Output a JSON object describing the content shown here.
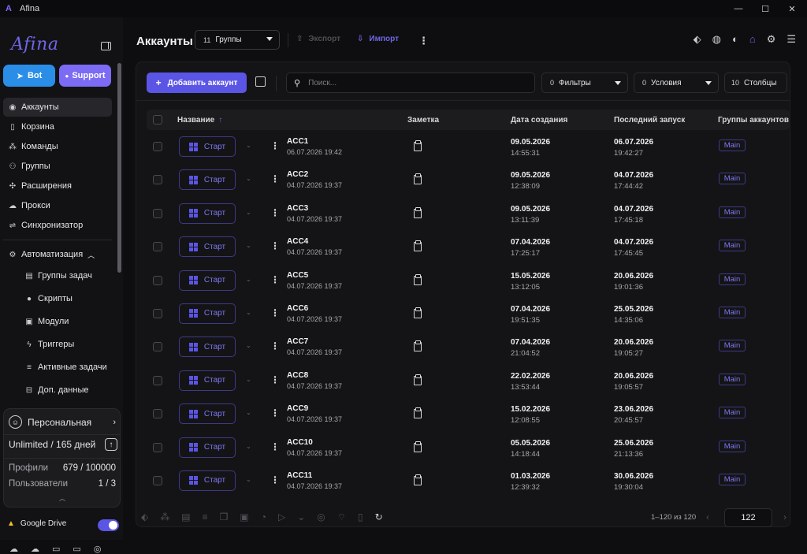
{
  "window": {
    "title": "Afina",
    "controls": [
      "minimize-icon",
      "maximize-icon",
      "close-icon"
    ]
  },
  "sidebar": {
    "brand": "Afina",
    "buttons": [
      {
        "label": "Bot",
        "color": "#2a8ee8"
      },
      {
        "label": "Support",
        "color": "#7c6cf5"
      }
    ],
    "items": [
      {
        "label": "Аккаунты",
        "icon": "user-circle-icon"
      },
      {
        "label": "Корзина",
        "icon": "trash-icon"
      },
      {
        "label": "Команды",
        "icon": "team-icon"
      },
      {
        "label": "Группы",
        "icon": "group-icon"
      },
      {
        "label": "Расширения",
        "icon": "puzzle-icon"
      },
      {
        "label": "Прокси",
        "icon": "cloud-icon"
      },
      {
        "label": "Синхронизатор",
        "icon": "sync-icon"
      }
    ],
    "automation": {
      "label": "Автоматизация",
      "subitems": [
        {
          "label": "Группы задач",
          "icon": "task-group-icon"
        },
        {
          "label": "Скрипты",
          "icon": "github-icon"
        },
        {
          "label": "Модули",
          "icon": "module-icon"
        },
        {
          "label": "Триггеры",
          "icon": "bolt-icon"
        },
        {
          "label": "Активные задачи",
          "icon": "list-icon"
        },
        {
          "label": "Доп. данные",
          "icon": "data-icon"
        }
      ]
    },
    "plan": {
      "name": "Персональная",
      "duration": "Unlimited / 165 дней",
      "profiles_label": "Профили",
      "profiles_value": "679 / 100000",
      "users_label": "Пользователи",
      "users_value": "1 / 3"
    },
    "gdrive": {
      "label": "Google Drive",
      "enabled": true
    }
  },
  "header": {
    "title": "Аккаунты",
    "group_count": "11",
    "group_label": "Группы",
    "export_label": "Экспорт",
    "import_label": "Импорт",
    "icons": [
      "tag-icon",
      "fingerprint-icon",
      "globe-icon",
      "robot-icon",
      "gear-icon",
      "layout-icon"
    ]
  },
  "toolbar": {
    "add_label": "Добавить аккаунт",
    "search_placeholder": "Поиск...",
    "filters_count": "0",
    "filters_label": "Фильтры",
    "conditions_count": "0",
    "conditions_label": "Условия",
    "columns_count": "10",
    "columns_label": "Столбцы"
  },
  "table": {
    "columns": [
      "Название",
      "Заметка",
      "Дата создания",
      "Последний запуск",
      "Группы аккаунтов"
    ],
    "start_label": "Старт",
    "rows": [
      {
        "name": "ACC1",
        "sub": "06.07.2026 19:42",
        "created_date": "09.05.2026",
        "created_time": "14:55:31",
        "last_date": "06.07.2026",
        "last_time": "19:42:27",
        "group": "Main"
      },
      {
        "name": "ACC2",
        "sub": "04.07.2026 19:37",
        "created_date": "09.05.2026",
        "created_time": "12:38:09",
        "last_date": "04.07.2026",
        "last_time": "17:44:42",
        "group": "Main"
      },
      {
        "name": "ACC3",
        "sub": "04.07.2026 19:37",
        "created_date": "09.05.2026",
        "created_time": "13:11:39",
        "last_date": "04.07.2026",
        "last_time": "17:45:18",
        "group": "Main"
      },
      {
        "name": "ACC4",
        "sub": "04.07.2026 19:37",
        "created_date": "07.04.2026",
        "created_time": "17:25:17",
        "last_date": "04.07.2026",
        "last_time": "17:45:45",
        "group": "Main"
      },
      {
        "name": "ACC5",
        "sub": "04.07.2026 19:37",
        "created_date": "15.05.2026",
        "created_time": "13:12:05",
        "last_date": "20.06.2026",
        "last_time": "19:01:36",
        "group": "Main"
      },
      {
        "name": "ACC6",
        "sub": "04.07.2026 19:37",
        "created_date": "07.04.2026",
        "created_time": "19:51:35",
        "last_date": "25.05.2026",
        "last_time": "14:35:06",
        "group": "Main"
      },
      {
        "name": "ACC7",
        "sub": "04.07.2026 19:37",
        "created_date": "07.04.2026",
        "created_time": "21:04:52",
        "last_date": "20.06.2026",
        "last_time": "19:05:27",
        "group": "Main"
      },
      {
        "name": "ACC8",
        "sub": "04.07.2026 19:37",
        "created_date": "22.02.2026",
        "created_time": "13:53:44",
        "last_date": "20.06.2026",
        "last_time": "19:05:57",
        "group": "Main"
      },
      {
        "name": "ACC9",
        "sub": "04.07.2026 19:37",
        "created_date": "15.02.2026",
        "created_time": "12:08:55",
        "last_date": "23.06.2026",
        "last_time": "20:45:57",
        "group": "Main"
      },
      {
        "name": "ACC10",
        "sub": "04.07.2026 19:37",
        "created_date": "05.05.2026",
        "created_time": "14:18:44",
        "last_date": "25.06.2026",
        "last_time": "21:13:36",
        "group": "Main"
      },
      {
        "name": "ACC11",
        "sub": "04.07.2026 19:37",
        "created_date": "01.03.2026",
        "created_time": "12:39:32",
        "last_date": "30.06.2026",
        "last_time": "19:30:04",
        "group": "Main"
      }
    ]
  },
  "footer": {
    "page_info": "1–120 из 120",
    "page_size": "122"
  }
}
